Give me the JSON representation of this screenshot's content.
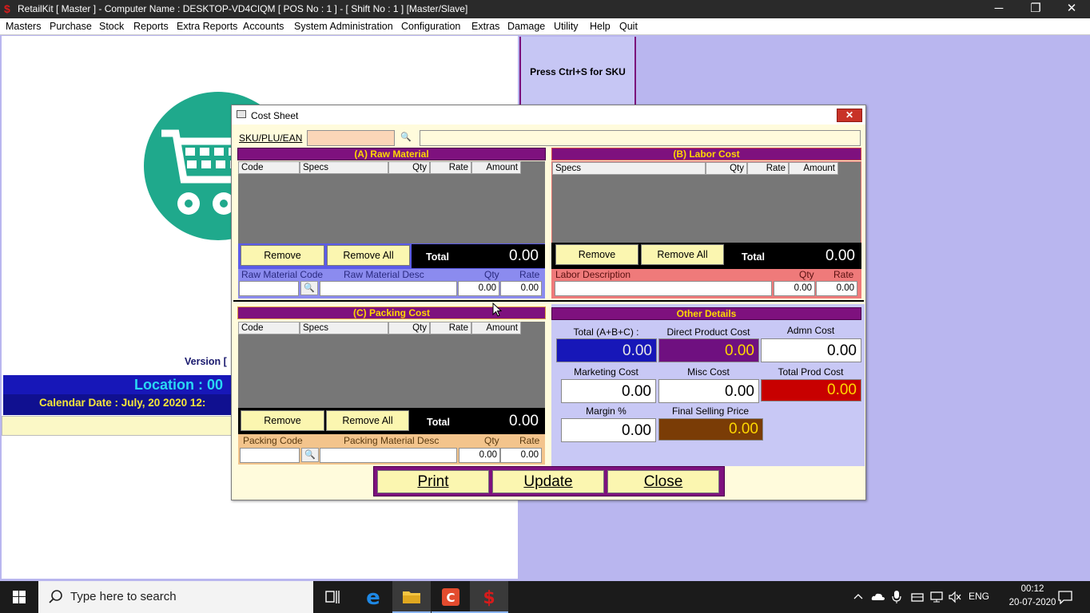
{
  "window": {
    "title": "RetailKit [ Master ] - Computer Name : DESKTOP-VD4CIQM [ POS No : 1 ] - [ Shift No : 1 ]  [Master/Slave]",
    "app_icon": "$",
    "controls": {
      "minimize": "─",
      "restore": "❐",
      "close": "✕"
    }
  },
  "menu": [
    "Masters",
    "Purchase",
    "Stock",
    "Reports",
    "Extra Reports",
    "Accounts",
    "System Administration",
    "Configuration",
    "Extras",
    "Damage",
    "Utility",
    "Help",
    "Quit"
  ],
  "background": {
    "version_label": "Version [",
    "location": "Location : 00",
    "calendar": "Calendar Date : July, 20 2020 12:",
    "sku_hint": "Press Ctrl+S for SKU"
  },
  "dialog": {
    "title": "Cost Sheet",
    "close_label": "✕",
    "sku_label": "SKU/PLU/EAN",
    "sku_value": "",
    "sku_desc": "",
    "raw_material": {
      "title": "(A) Raw Material",
      "columns": [
        "Code",
        "Specs",
        "Qty",
        "Rate",
        "Amount"
      ],
      "remove": "Remove",
      "remove_all": "Remove All",
      "total_label": "Total",
      "total": "0.00",
      "code_label": "Raw Material Code",
      "desc_label": "Raw Material Desc",
      "qty_label": "Qty",
      "rate_label": "Rate",
      "code": "",
      "desc": "",
      "qty": "0.00",
      "rate": "0.00"
    },
    "labor_cost": {
      "title": "(B) Labor Cost",
      "columns": [
        "Specs",
        "Qty",
        "Rate",
        "Amount"
      ],
      "remove": "Remove",
      "remove_all": "Remove All",
      "total_label": "Total",
      "total": "0.00",
      "desc_label": "Labor Description",
      "qty_label": "Qty",
      "rate_label": "Rate",
      "desc": "",
      "qty": "0.00",
      "rate": "0.00"
    },
    "packing_cost": {
      "title": "(C) Packing Cost",
      "columns": [
        "Code",
        "Specs",
        "Qty",
        "Rate",
        "Amount"
      ],
      "remove": "Remove",
      "remove_all": "Remove All",
      "total_label": "Total",
      "total": "0.00",
      "code_label": "Packing Code",
      "desc_label": "Packing Material Desc",
      "qty_label": "Qty",
      "rate_label": "Rate",
      "code": "",
      "desc": "",
      "qty": "0.00",
      "rate": "0.00"
    },
    "other_details": {
      "title": "Other Details",
      "total_abc_label": "Total (A+B+C) :",
      "total_abc": "0.00",
      "direct_cost_label": "Direct Product Cost",
      "direct_cost": "0.00",
      "admn_cost_label": "Admn Cost",
      "admn_cost": "0.00",
      "marketing_label": "Marketing Cost",
      "marketing": "0.00",
      "misc_label": "Misc Cost",
      "misc": "0.00",
      "total_prod_label": "Total Prod Cost",
      "total_prod": "0.00",
      "margin_label": "Margin %",
      "margin": "0.00",
      "final_price_label": "Final Selling Price",
      "final_price": "0.00"
    },
    "buttons": {
      "print": "Print",
      "update": "Update",
      "close": "Close"
    }
  },
  "taskbar": {
    "search_placeholder": "Type here to search",
    "language": "ENG",
    "time": "00:12",
    "date": "20-07-2020"
  },
  "colors": {
    "panel_header": "#7e117e",
    "panel_header_text": "#ffd700",
    "total_abc_bg": "#1717b8",
    "direct_cost_bg": "#6f1080",
    "total_prod_bg": "#c80000",
    "final_price_bg": "#7a3c06",
    "desktop_bg": "#b9b6ef"
  }
}
